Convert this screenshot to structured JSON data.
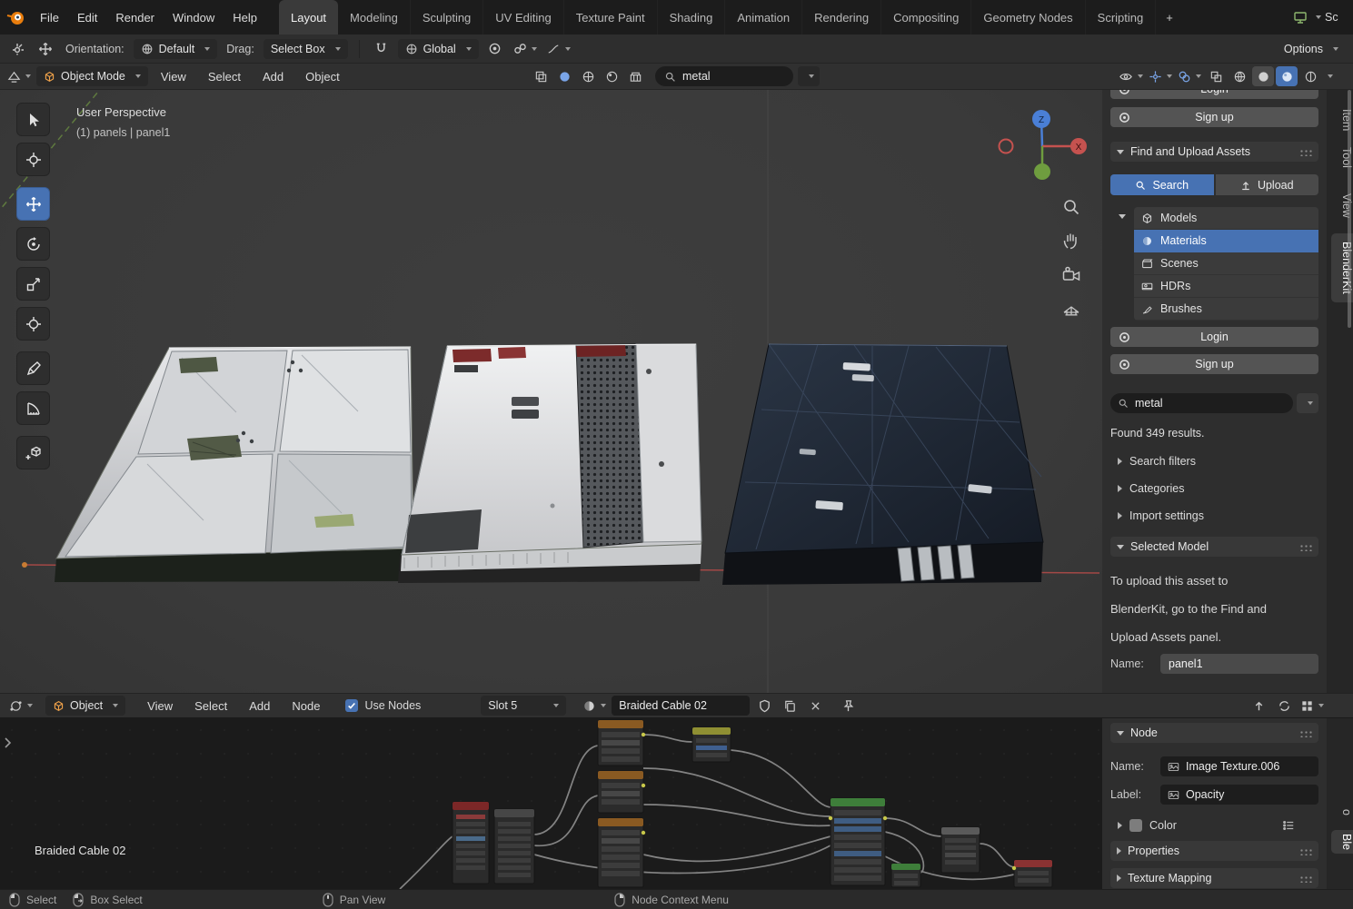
{
  "colors": {
    "accent": "#4772b3",
    "axis_x": "#c5524f",
    "axis_y": "#6f9d3f",
    "axis_z": "#4a7fd6"
  },
  "topbar": {
    "menus": [
      "File",
      "Edit",
      "Render",
      "Window",
      "Help"
    ],
    "workspaces": [
      "Layout",
      "Modeling",
      "Sculpting",
      "UV Editing",
      "Texture Paint",
      "Shading",
      "Animation",
      "Rendering",
      "Compositing",
      "Geometry Nodes",
      "Scripting"
    ],
    "active_workspace": "Layout",
    "add_tab": "+",
    "scene_label": "Sc"
  },
  "tool_settings": {
    "orientation_label": "Orientation:",
    "orientation_value": "Default",
    "drag_label": "Drag:",
    "drag_value": "Select Box",
    "snap_target": "Global",
    "options_label": "Options"
  },
  "viewport_header": {
    "mode": "Object Mode",
    "menus": [
      "View",
      "Select",
      "Add",
      "Object"
    ],
    "search_value": "metal"
  },
  "viewport": {
    "view_label": "User Perspective",
    "breadcrumb": "(1) panels | panel1",
    "axis_z": "Z",
    "axis_x": "X"
  },
  "sidebar": {
    "tabs": [
      "Item",
      "Tool",
      "View",
      "BlenderKit"
    ],
    "active_tab": "BlenderKit",
    "login_partial": "Login",
    "signup_top": "Sign up",
    "section_find_upload": "Find and Upload Assets",
    "tab_search": "Search",
    "tab_upload": "Upload",
    "asset_types": [
      "Models",
      "Materials",
      "Scenes",
      "HDRs",
      "Brushes"
    ],
    "selected_asset_type": "Materials",
    "login": "Login",
    "signup": "Sign up",
    "search_value": "metal",
    "results": "Found 349 results.",
    "expand_search_filters": "Search filters",
    "expand_categories": "Categories",
    "expand_import_settings": "Import settings",
    "section_selected_model": "Selected Model",
    "hint_line1": "To upload this asset to",
    "hint_line2": "BlenderKit, go to the Find and",
    "hint_line3": "Upload Assets panel.",
    "name_label": "Name:",
    "name_value": "panel1"
  },
  "shader_header": {
    "id_type": "Object",
    "menus": [
      "View",
      "Select",
      "Add",
      "Node"
    ],
    "use_nodes": "Use Nodes",
    "slot": "Slot 5",
    "material": "Braided Cable 02"
  },
  "node_editor": {
    "material_label": "Braided Cable 02"
  },
  "node_panel": {
    "section_node": "Node",
    "name_label": "Name:",
    "name_value": "Image Texture.006",
    "label_label": "Label:",
    "label_value": "Opacity",
    "color": "Color",
    "section_properties": "Properties",
    "section_texture_mapping": "Texture Mapping",
    "edge_tab_top": "o",
    "edge_tab_bottom": "Ble"
  },
  "statusbar": {
    "select": "Select",
    "box_select": "Box Select",
    "pan_view": "Pan View",
    "context_menu": "Node Context Menu"
  }
}
